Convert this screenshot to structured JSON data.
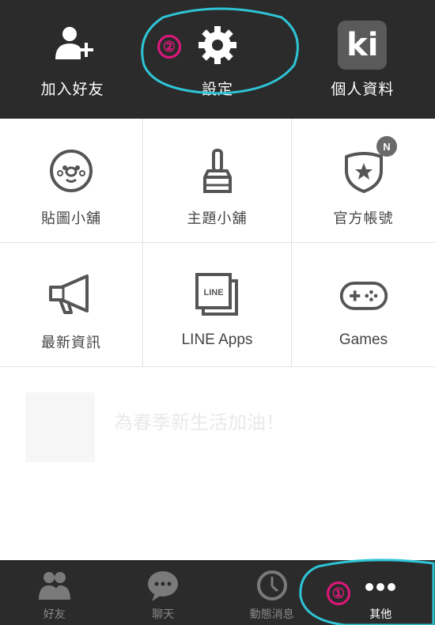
{
  "top": {
    "add_friend": "加入好友",
    "settings": "設定",
    "profile": "個人資料",
    "profile_logo_text": "ki"
  },
  "grid": {
    "items": [
      {
        "label": "貼圖小舖",
        "icon": "sticker-face-icon"
      },
      {
        "label": "主題小舖",
        "icon": "paint-brush-icon"
      },
      {
        "label": "官方帳號",
        "icon": "shield-star-icon",
        "badge": "N"
      },
      {
        "label": "最新資訊",
        "icon": "megaphone-icon"
      },
      {
        "label": "LINE Apps",
        "icon": "line-apps-icon",
        "icon_text": "LINE"
      },
      {
        "label": "Games",
        "icon": "gamepad-icon"
      }
    ]
  },
  "banner": {
    "title": "為春季新生活加油！"
  },
  "tabs": [
    {
      "label": "好友",
      "icon": "friends-icon"
    },
    {
      "label": "聊天",
      "icon": "chat-bubble-icon"
    },
    {
      "label": "動態消息",
      "icon": "clock-icon"
    },
    {
      "label": "其他",
      "icon": "more-dots-icon",
      "active": true
    }
  ],
  "annotations": {
    "marker_1": "①",
    "marker_2": "②",
    "color": "#e0177d",
    "highlight_color": "#2ec4d6"
  },
  "colors": {
    "bar_bg": "#2b2b2b",
    "icon_gray": "#555555"
  }
}
